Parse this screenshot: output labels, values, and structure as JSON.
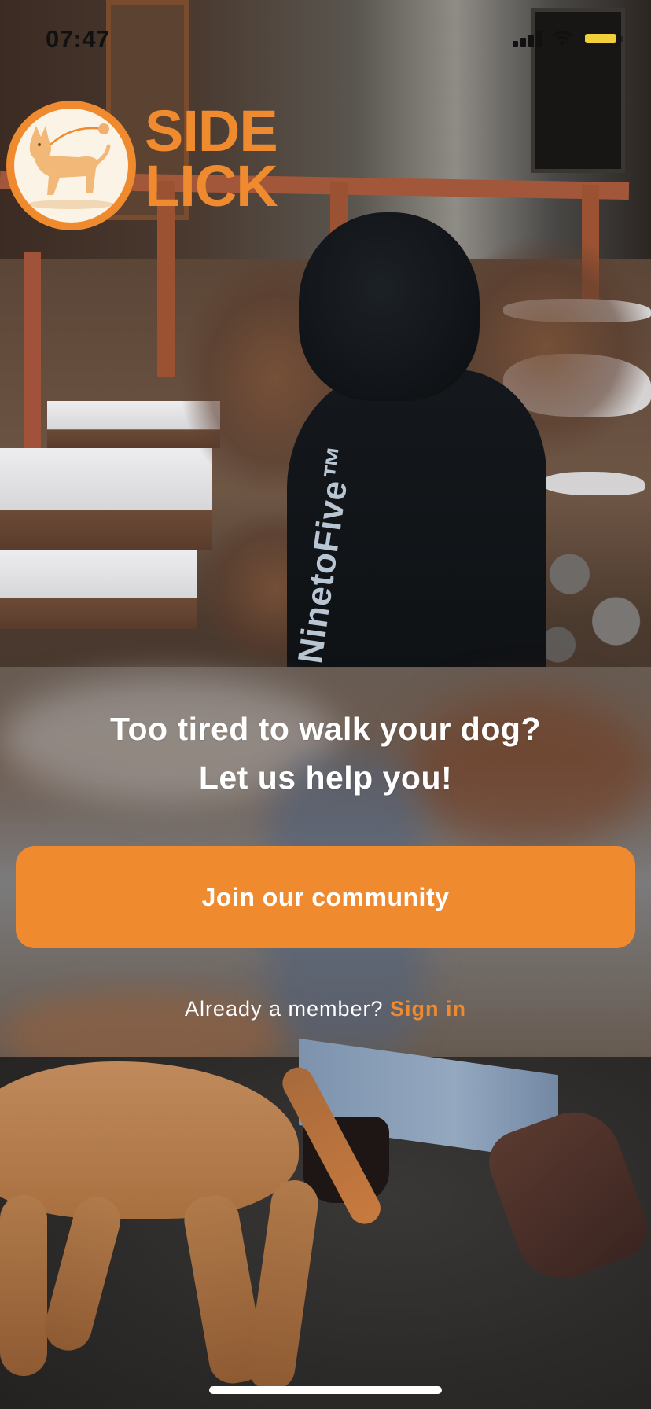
{
  "status_bar": {
    "time": "07:47",
    "icons": [
      "cellular-signal-icon",
      "wifi-icon",
      "battery-icon"
    ],
    "battery_color": "#f1cf3b"
  },
  "brand": {
    "logo_line1": "SIDE",
    "logo_line2": "LICK",
    "logo_icon": "dog-on-leash-icon",
    "accent_color": "#ef8a2f"
  },
  "background": {
    "sleeve_text": "NinetoFive™"
  },
  "content": {
    "headline_line1": "Too tired to walk your dog?",
    "headline_line2": "Let us help you!",
    "cta_label": "Join our community",
    "signin_prompt": "Already a member? ",
    "signin_link": "Sign in"
  }
}
